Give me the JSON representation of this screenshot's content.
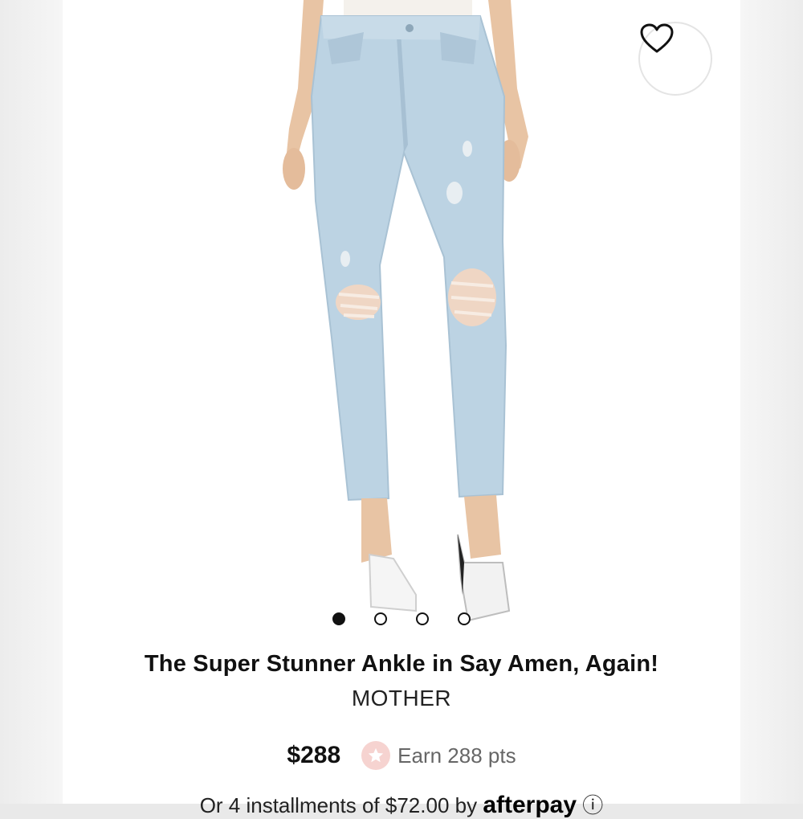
{
  "product": {
    "title": "The Super Stunner Ankle in Say Amen, Again!",
    "brand": "MOTHER",
    "price": "$288",
    "points_label": "Earn 288 pts",
    "installments_text": "Or 4 installments of $72.00 by",
    "installments_provider": "afterpay"
  },
  "gallery": {
    "image_count": 4,
    "active_index": 0
  },
  "icons": {
    "wishlist": "heart-icon",
    "points": "star-icon",
    "afterpay": "afterpay-logo-icon",
    "info": "info-icon"
  },
  "colors": {
    "text": "#111111",
    "muted": "#666666",
    "points_badge": "#f6d3d0",
    "denim": "#bcd3e3"
  }
}
